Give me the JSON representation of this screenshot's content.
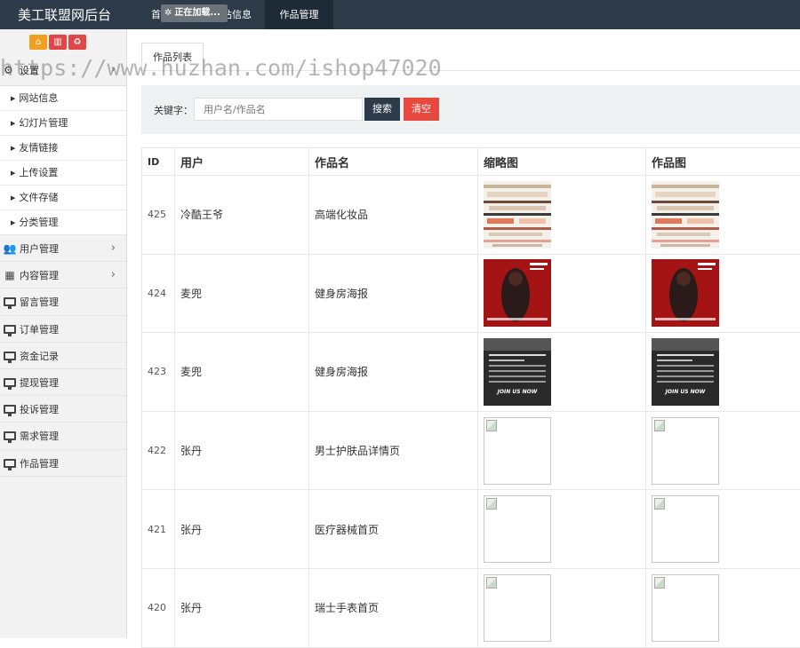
{
  "header": {
    "brand": "美工联盟网后台",
    "nav_home": "首",
    "nav_site": "站信息",
    "nav_works": "作品管理",
    "loading": "正在加载..."
  },
  "sidebar": {
    "tools": [
      "home-icon",
      "trash-icon",
      "recycle-icon"
    ],
    "settings": {
      "label": "设置",
      "subs": [
        "网站信息",
        "幻灯片管理",
        "友情链接",
        "上传设置",
        "文件存储",
        "分类管理"
      ]
    },
    "items": [
      {
        "label": "用户管理",
        "icon": "users-icon",
        "chevron": true
      },
      {
        "label": "内容管理",
        "icon": "grid-icon",
        "chevron": true
      },
      {
        "label": "留言管理",
        "icon": "monitor-icon"
      },
      {
        "label": "订单管理",
        "icon": "monitor-icon"
      },
      {
        "label": "资金记录",
        "icon": "monitor-icon"
      },
      {
        "label": "提现管理",
        "icon": "monitor-icon"
      },
      {
        "label": "投诉管理",
        "icon": "monitor-icon"
      },
      {
        "label": "需求管理",
        "icon": "monitor-icon"
      },
      {
        "label": "作品管理",
        "icon": "monitor-icon"
      }
    ]
  },
  "main": {
    "tab": "作品列表",
    "search": {
      "label": "关键字：",
      "placeholder": "用户名/作品名",
      "search_btn": "搜索",
      "clear_btn": "清空"
    },
    "watermark": "https://www.huzhan.com/ishop47020",
    "table": {
      "headers": [
        "ID",
        "用户",
        "作品名",
        "缩略图",
        "作品图"
      ],
      "rows": [
        {
          "id": "425",
          "user": "冷酷王爷",
          "name": "高端化妆品",
          "image": "cosmetics"
        },
        {
          "id": "424",
          "user": "麦兜",
          "name": "健身房海报",
          "image": "gym-red"
        },
        {
          "id": "423",
          "user": "麦兜",
          "name": "健身房海报",
          "image": "gym-dark"
        },
        {
          "id": "422",
          "user": "张丹",
          "name": "男士护肤品详情页",
          "image": "broken"
        },
        {
          "id": "421",
          "user": "张丹",
          "name": "医疗器械首页",
          "image": "broken"
        },
        {
          "id": "420",
          "user": "张丹",
          "name": "瑞士手表首页",
          "image": "broken"
        }
      ]
    },
    "thumb_text": "JOIN US NOW"
  },
  "colors": {
    "topbar": "#2c3a4a",
    "search_button": "#2c3a4a",
    "clear_button": "#e8493f",
    "tool_home": "#f0a020",
    "tool_red": "#e04848"
  }
}
